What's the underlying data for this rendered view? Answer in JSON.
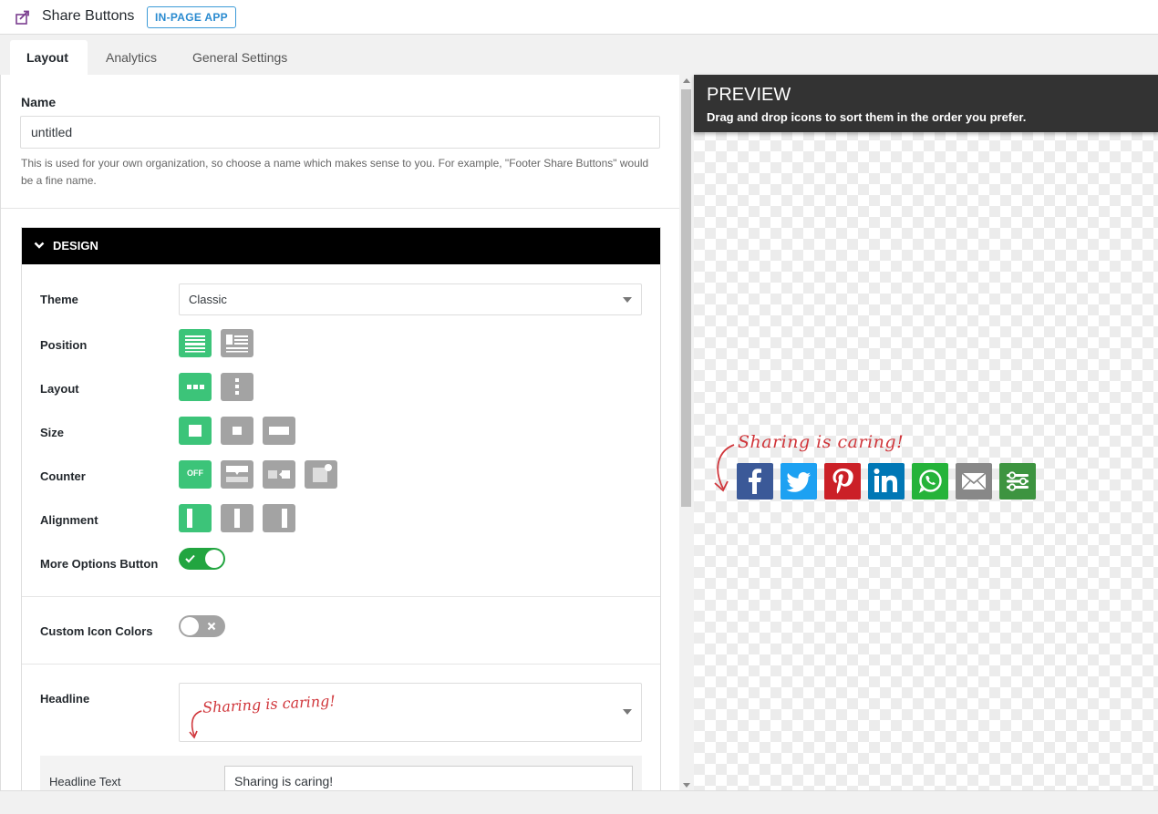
{
  "header": {
    "title": "Share Buttons",
    "badge": "IN-PAGE APP",
    "icon": "share-arrow-icon"
  },
  "tabs": [
    {
      "label": "Layout",
      "active": true
    },
    {
      "label": "Analytics",
      "active": false
    },
    {
      "label": "General Settings",
      "active": false
    }
  ],
  "form": {
    "name_label": "Name",
    "name_value": "untitled",
    "name_help": "This is used for your own organization, so choose a name which makes sense to you. For example, \"Footer Share Buttons\" would be a fine name.",
    "design": {
      "title": "DESIGN",
      "theme_label": "Theme",
      "theme_value": "Classic",
      "position_label": "Position",
      "layout_label": "Layout",
      "size_label": "Size",
      "counter_label": "Counter",
      "counter_off_text": "OFF",
      "alignment_label": "Alignment",
      "more_options_label": "More Options Button",
      "more_options_on": true,
      "custom_colors_label": "Custom Icon Colors",
      "custom_colors_on": false,
      "headline_label": "Headline",
      "headline_preview": "Sharing is caring!",
      "headline_text_label": "Headline Text",
      "headline_text_value": "Sharing is caring!"
    }
  },
  "preview": {
    "title": "PREVIEW",
    "subtitle": "Drag and drop icons to sort them in the order you prefer.",
    "headline": "Sharing is caring!",
    "icons": [
      {
        "name": "facebook-icon",
        "color": "#3b5998"
      },
      {
        "name": "twitter-icon",
        "color": "#1da1f2"
      },
      {
        "name": "pinterest-icon",
        "color": "#cb2027"
      },
      {
        "name": "linkedin-icon",
        "color": "#0077b5"
      },
      {
        "name": "whatsapp-icon",
        "color": "#25b33a"
      },
      {
        "name": "email-icon",
        "color": "#888888"
      },
      {
        "name": "more-options-icon",
        "color": "#3d9440"
      }
    ]
  },
  "colors": {
    "accent_green": "#3cc479",
    "toggle_on": "#22a540",
    "inactive_gray": "#a3a3a3",
    "badge_blue": "#2a8bd0"
  }
}
